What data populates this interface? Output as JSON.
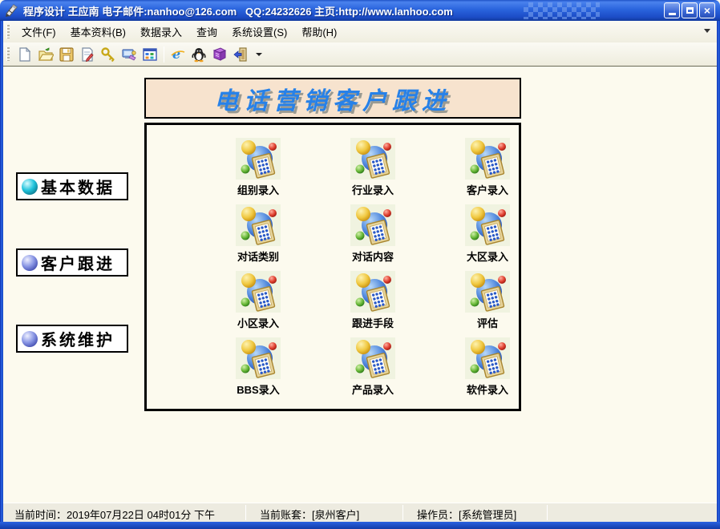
{
  "window": {
    "title": "程序设计 王应南 电子邮件:nanhoo@126.com   QQ:24232626 主页:http://www.lanhoo.com",
    "controls": [
      "minimize",
      "maximize",
      "close"
    ],
    "accent_color": "#2A62DD",
    "border_color": "#1445C2"
  },
  "menubar": {
    "items": [
      {
        "label": "文件(F)"
      },
      {
        "label": "基本资料(B)"
      },
      {
        "label": "数据录入"
      },
      {
        "label": "查询"
      },
      {
        "label": "系统设置(S)"
      },
      {
        "label": "帮助(H)"
      }
    ]
  },
  "toolbar": {
    "icons": [
      "new-file-icon",
      "open-folder-icon",
      "save-icon",
      "edit-document-icon",
      "key-icon",
      "system-config-icon",
      "grid-view-icon",
      "internet-explorer-icon",
      "qq-icon",
      "help-book-icon",
      "exit-icon",
      "dropdown-arrow-icon"
    ]
  },
  "sidebar": {
    "buttons": [
      {
        "label": "基本数据"
      },
      {
        "label": "客户跟进"
      },
      {
        "label": "系统维护"
      }
    ]
  },
  "main": {
    "banner": "电话营销客户跟进",
    "banner_bg": "#F7E3CE",
    "banner_text_color": "#2781E8",
    "grid": {
      "items": [
        {
          "label": "组别录入"
        },
        {
          "label": "行业录入"
        },
        {
          "label": "客户录入"
        },
        {
          "label": "对话类别"
        },
        {
          "label": "对话内容"
        },
        {
          "label": "大区录入"
        },
        {
          "label": "小区录入"
        },
        {
          "label": "跟进手段"
        },
        {
          "label": "评估"
        },
        {
          "label": "BBS录入"
        },
        {
          "label": "产品录入"
        },
        {
          "label": "软件录入"
        }
      ]
    }
  },
  "statusbar": {
    "time_label": "当前时间：",
    "time_value": "2019年07月22日 04时01分 下午",
    "account_label": "当前账套：",
    "account_value": "[泉州客户]",
    "operator_label": "操作员：",
    "operator_value": "[系统管理员]"
  }
}
